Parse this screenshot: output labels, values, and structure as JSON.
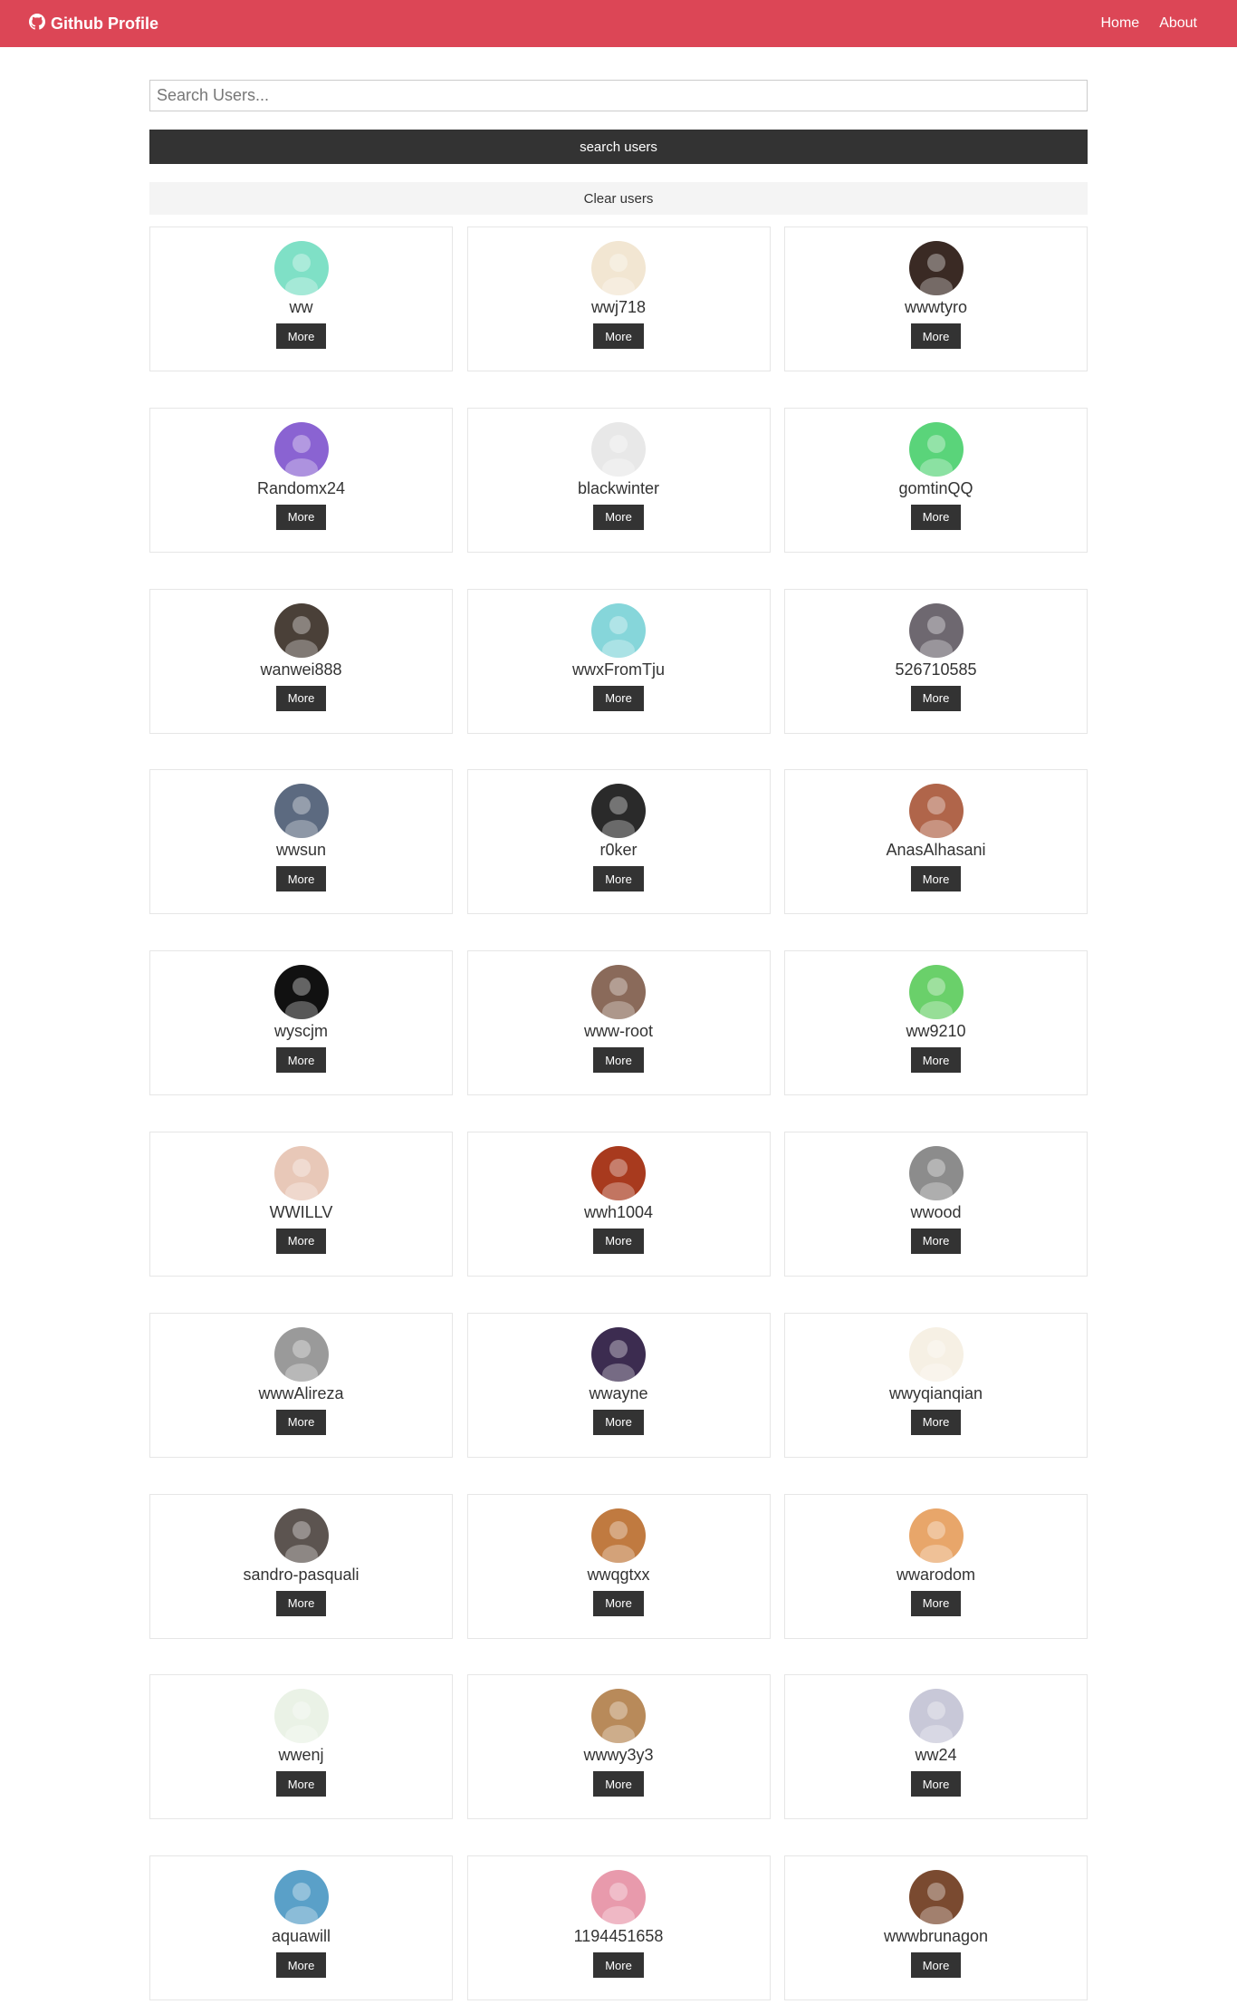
{
  "navbar": {
    "brand_icon": "github-icon",
    "brand_text": "Github Profile",
    "links": [
      "Home",
      "About"
    ]
  },
  "search": {
    "placeholder": "Search Users...",
    "value": "",
    "submit_label": "search users",
    "clear_label": "Clear users"
  },
  "colors": {
    "navbar": "#dc4656",
    "dark_button": "#333333",
    "light_button": "#f4f4f4"
  },
  "users": [
    {
      "login": "ww",
      "button": "More",
      "avatar_color": "#7fe0c6"
    },
    {
      "login": "wwj718",
      "button": "More",
      "avatar_color": "#f2e6d2"
    },
    {
      "login": "wwwtyro",
      "button": "More",
      "avatar_color": "#3a2a24"
    },
    {
      "login": "Randomx24",
      "button": "More",
      "avatar_color": "#8a63d2"
    },
    {
      "login": "blackwinter",
      "button": "More",
      "avatar_color": "#e8e8e8"
    },
    {
      "login": "gomtinQQ",
      "button": "More",
      "avatar_color": "#5ad47a"
    },
    {
      "login": "wanwei888",
      "button": "More",
      "avatar_color": "#4a4038"
    },
    {
      "login": "wwxFromTju",
      "button": "More",
      "avatar_color": "#86d6da"
    },
    {
      "login": "526710585",
      "button": "More",
      "avatar_color": "#6e6870"
    },
    {
      "login": "wwsun",
      "button": "More",
      "avatar_color": "#5c6a80"
    },
    {
      "login": "r0ker",
      "button": "More",
      "avatar_color": "#2a2a2a"
    },
    {
      "login": "AnasAlhasani",
      "button": "More",
      "avatar_color": "#b0654a"
    },
    {
      "login": "wyscjm",
      "button": "More",
      "avatar_color": "#111111"
    },
    {
      "login": "www-root",
      "button": "More",
      "avatar_color": "#8a6a5a"
    },
    {
      "login": "ww9210",
      "button": "More",
      "avatar_color": "#6ad06a"
    },
    {
      "login": "WWILLV",
      "button": "More",
      "avatar_color": "#e8c8b8"
    },
    {
      "login": "wwh1004",
      "button": "More",
      "avatar_color": "#a83a1e"
    },
    {
      "login": "wwood",
      "button": "More",
      "avatar_color": "#8c8c8c"
    },
    {
      "login": "wwwAlireza",
      "button": "More",
      "avatar_color": "#9a9a9a"
    },
    {
      "login": "wwayne",
      "button": "More",
      "avatar_color": "#3c2c50"
    },
    {
      "login": "wwyqianqian",
      "button": "More",
      "avatar_color": "#f6f0e4"
    },
    {
      "login": "sandro-pasquali",
      "button": "More",
      "avatar_color": "#5c5450"
    },
    {
      "login": "wwqgtxx",
      "button": "More",
      "avatar_color": "#c07a40"
    },
    {
      "login": "wwarodom",
      "button": "More",
      "avatar_color": "#e8a66a"
    },
    {
      "login": "wwenj",
      "button": "More",
      "avatar_color": "#eaf2e6"
    },
    {
      "login": "wwwy3y3",
      "button": "More",
      "avatar_color": "#b88a5a"
    },
    {
      "login": "ww24",
      "button": "More",
      "avatar_color": "#c8c8d8"
    },
    {
      "login": "aquawill",
      "button": "More",
      "avatar_color": "#5aa0c8"
    },
    {
      "login": "1194451658",
      "button": "More",
      "avatar_color": "#e89aac"
    },
    {
      "login": "wwwbrunagon",
      "button": "More",
      "avatar_color": "#7a4a30"
    }
  ]
}
